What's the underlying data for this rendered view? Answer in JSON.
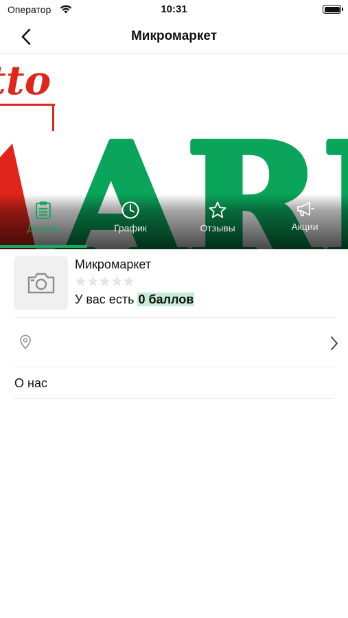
{
  "status_bar": {
    "carrier": "Оператор",
    "time": "10:31",
    "icons": [
      "wifi-icon",
      "battery-icon"
    ]
  },
  "nav": {
    "back_icon": "chevron-left-icon",
    "title": "Микромаркет"
  },
  "hero": {
    "banner_text_top": "tto",
    "banner_text_main": "ARK",
    "colors": {
      "red": "#e0251b",
      "green": "#0aa55a"
    }
  },
  "tabs": [
    {
      "label": "Детали",
      "icon": "clipboard-icon",
      "active": true
    },
    {
      "label": "График",
      "icon": "clock-icon",
      "active": false
    },
    {
      "label": "Отзывы",
      "icon": "star-icon",
      "active": false
    },
    {
      "label": "Акции",
      "icon": "megaphone-icon",
      "active": false
    }
  ],
  "store": {
    "photo_icon": "camera-icon",
    "name": "Микромаркет",
    "rating": 0,
    "rating_max": 5,
    "points_prefix": "У вас есть",
    "points_value": "0 баллов"
  },
  "address_row": {
    "icon": "location-pin-icon",
    "chevron": "chevron-right-icon"
  },
  "about_row": {
    "label": "О нас"
  },
  "theme": {
    "accent": "#1aa561",
    "points_bg": "#c6ecd6",
    "divider": "#ececec"
  }
}
